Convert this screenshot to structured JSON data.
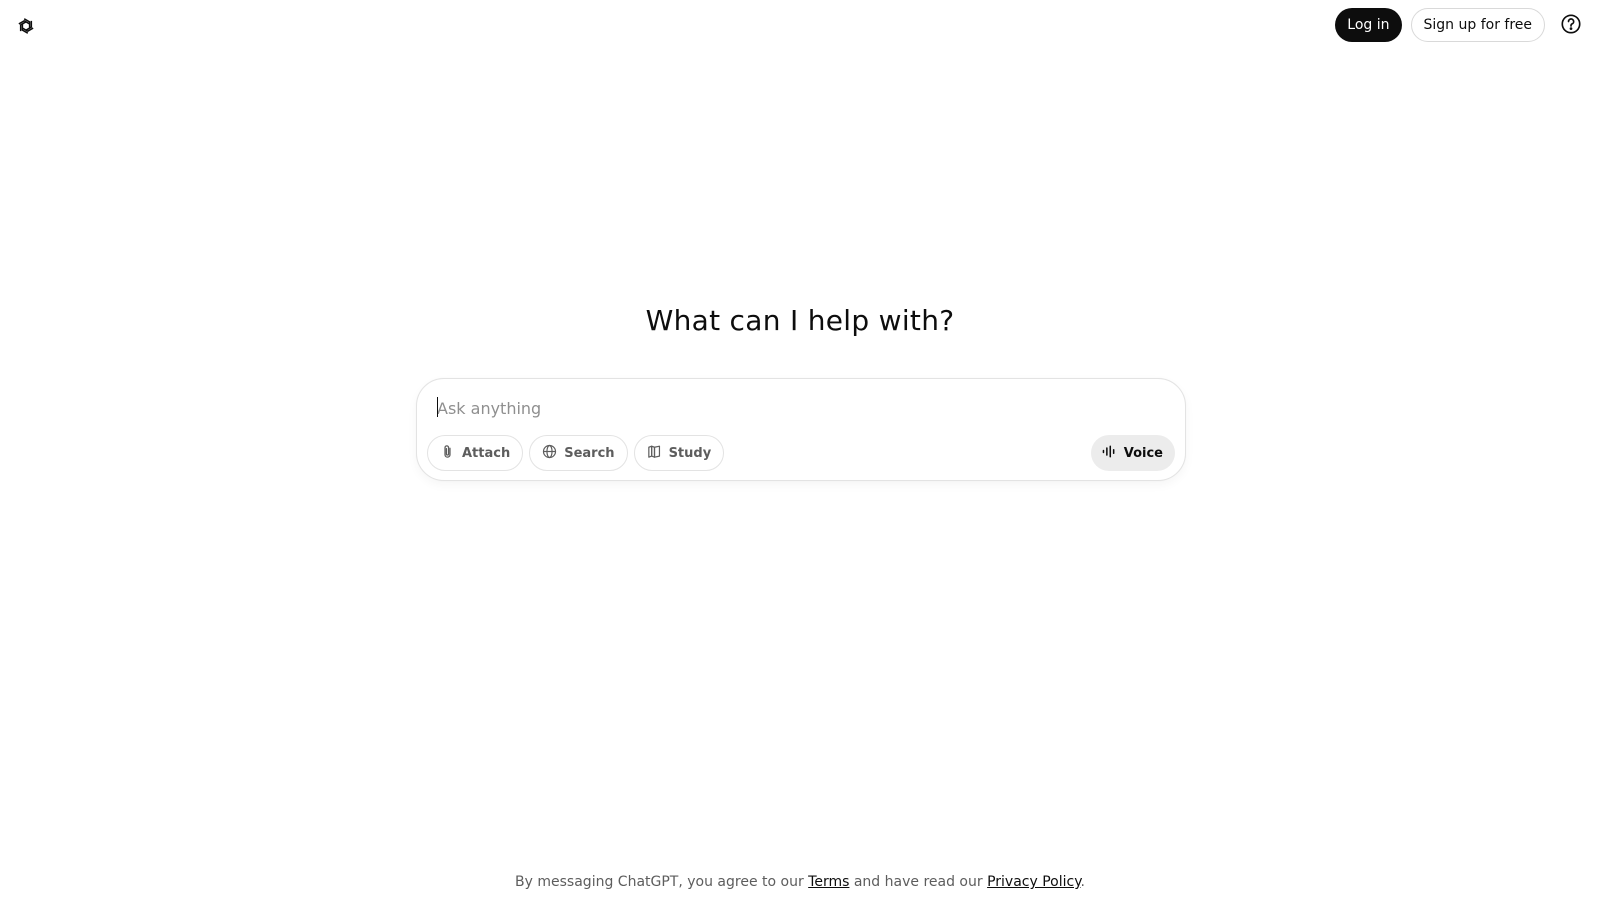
{
  "header": {
    "logo_icon": "openai-logo-icon",
    "login_label": "Log in",
    "signup_label": "Sign up for free",
    "help_icon": "question-circle-icon"
  },
  "main": {
    "headline": "What can I help with?",
    "composer": {
      "placeholder": "Ask anything",
      "value": "",
      "tools": [
        {
          "label": "Attach",
          "icon": "paperclip-icon"
        },
        {
          "label": "Search",
          "icon": "globe-icon"
        },
        {
          "label": "Study",
          "icon": "book-icon"
        }
      ],
      "voice_label": "Voice",
      "voice_icon": "waveform-icon"
    }
  },
  "footer": {
    "prefix": "By messaging ChatGPT, you agree to our ",
    "terms_link": "Terms",
    "middle": " and have read our ",
    "privacy_link": "Privacy Policy",
    "suffix": "."
  },
  "colors": {
    "primary": "#0d0d0d",
    "muted_text": "#5d5d5d",
    "border": "#e3e3e3",
    "voice_bg": "#ececec"
  }
}
